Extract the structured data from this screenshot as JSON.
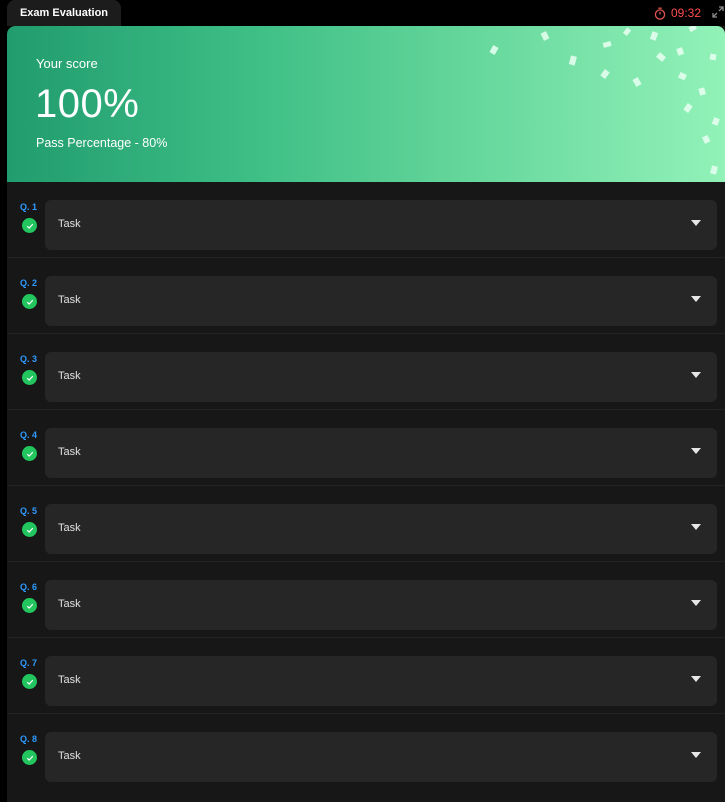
{
  "window": {
    "tab_title": "Exam Evaluation",
    "timer": "09:32",
    "icons": [
      "stopwatch-icon",
      "expand-icon"
    ]
  },
  "result": {
    "score_label": "Your score",
    "score": "100%",
    "pass_text": "Pass Percentage - 80%"
  },
  "colors": {
    "accent_green": "#22c55e",
    "question_number_blue": "#2f9bff",
    "timer_red": "#ff4d4f"
  },
  "questions": [
    {
      "number": "Q. 1",
      "title": "Task",
      "status": "correct"
    },
    {
      "number": "Q. 2",
      "title": "Task",
      "status": "correct"
    },
    {
      "number": "Q. 3",
      "title": "Task",
      "status": "correct"
    },
    {
      "number": "Q. 4",
      "title": "Task",
      "status": "correct"
    },
    {
      "number": "Q. 5",
      "title": "Task",
      "status": "correct"
    },
    {
      "number": "Q. 6",
      "title": "Task",
      "status": "correct"
    },
    {
      "number": "Q. 7",
      "title": "Task",
      "status": "correct"
    },
    {
      "number": "Q. 8",
      "title": "Task",
      "status": "correct"
    }
  ]
}
